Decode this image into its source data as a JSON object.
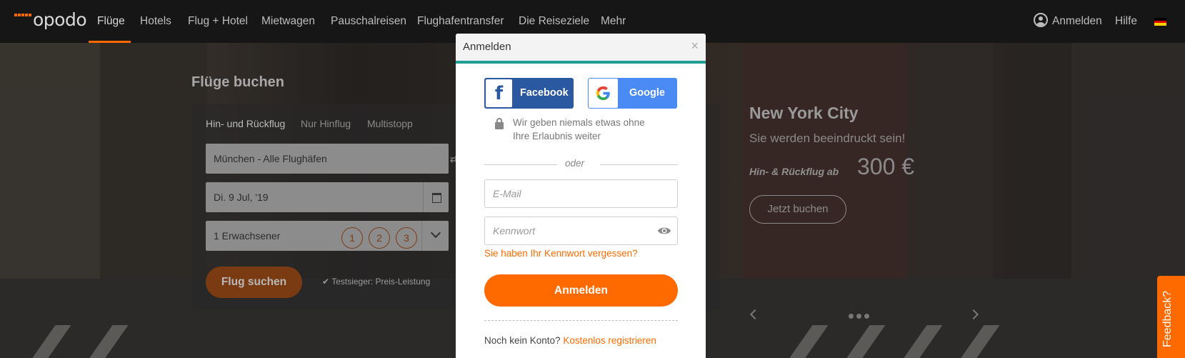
{
  "nav": {
    "logo": "opodo",
    "items": [
      {
        "label": "Flüge",
        "active": true
      },
      {
        "label": "Hotels"
      },
      {
        "label": "Flug + Hotel"
      },
      {
        "label": "Mietwagen"
      },
      {
        "label": "Pauschalreisen"
      },
      {
        "label": "Flughafentransfer"
      },
      {
        "label": "Die Reiseziele"
      },
      {
        "label": "Mehr"
      }
    ],
    "login": "Anmelden",
    "help": "Hilfe",
    "language_flag": "germany-flag-icon"
  },
  "search": {
    "title": "Flüge buchen",
    "trip_types": [
      "Hin- und Rückflug",
      "Nur Hinflug",
      "Multistopp"
    ],
    "origin": "München - Alle Flughäfen",
    "date": "Di. 9 Jul, '19",
    "passengers": "1 Erwachsener",
    "passenger_options": [
      "1",
      "2",
      "3"
    ],
    "button": "Flug suchen",
    "badge": "Testsieger: Preis-Leistung"
  },
  "promo": {
    "city": "New York City",
    "subtitle": "Sie werden beeindruckt sein!",
    "from_label": "Hin- & Rückflug ab",
    "price": "300 €",
    "cta": "Jetzt buchen"
  },
  "feedback": "Feedback?",
  "modal": {
    "title": "Anmelden",
    "close": "×",
    "facebook": "Facebook",
    "google": "Google",
    "privacy": "Wir geben niemals etwas ohne Ihre Erlaubnis weiter",
    "or": "oder",
    "email_placeholder": "E-Mail",
    "password_placeholder": "Kennwort",
    "forgot": "Sie haben Ihr Kennwort vergessen?",
    "submit": "Anmelden",
    "no_account": "Noch kein Konto?",
    "register": "Kostenlos registrieren"
  },
  "colors": {
    "brand_orange": "#ff6a00",
    "teal_accent": "#1f9e96",
    "facebook_blue": "#2a59a2",
    "google_blue": "#4a8af4"
  }
}
